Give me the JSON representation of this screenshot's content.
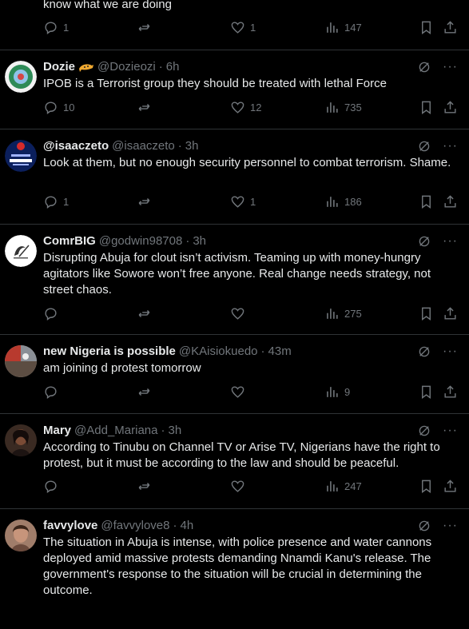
{
  "tweets": [
    {
      "partial": true,
      "text": "know what we are doing",
      "replies": "1",
      "reposts": "",
      "likes": "1",
      "views": "147"
    },
    {
      "name": "Dozie",
      "badge": true,
      "handle": "@Dozieozi",
      "time": "6h",
      "text": "IPOB is a Terrorist group they should be treated with lethal Force",
      "replies": "10",
      "reposts": "",
      "likes": "12",
      "views": "735"
    },
    {
      "name": "@isaaczeto",
      "handle": "@isaaczeto",
      "time": "3h",
      "text": "Look at them, but no enough security personnel to combat terrorism. Shame.",
      "replies": "1",
      "reposts": "",
      "likes": "1",
      "views": "186"
    },
    {
      "name": "ComrBIG",
      "handle": "@godwin98708",
      "time": "3h",
      "text": "Disrupting Abuja for clout isn’t activism. Teaming up with money-hungry agitators like Sowore won’t free anyone. Real change needs strategy, not street chaos.",
      "replies": "",
      "reposts": "",
      "likes": "",
      "views": "275"
    },
    {
      "name": "new Nigeria is possible",
      "handle": "@KAisiokuedo",
      "time": "43m",
      "text": "am joining d protest tomorrow",
      "replies": "",
      "reposts": "",
      "likes": "",
      "views": "9"
    },
    {
      "name": "Mary",
      "handle": "@Add_Mariana",
      "time": "3h",
      "text": "According to Tinubu on Channel TV or Arise TV, Nigerians have the right to protest, but it must be according to the law and should be peaceful.",
      "replies": "",
      "reposts": "",
      "likes": "",
      "views": "247"
    },
    {
      "name": "favvylove",
      "handle": "@favvylove8",
      "time": "4h",
      "text": "The situation in Abuja is intense, with police presence and water cannons deployed amid massive protests demanding Nnamdi Kanu's release. The government's response to the situation will be crucial in determining the outcome.",
      "replies": "",
      "reposts": "",
      "likes": "",
      "views": ""
    }
  ],
  "colors": {
    "background": "#000000",
    "text": "#e7e9ea",
    "muted": "#71767b",
    "divider": "#2f3336"
  },
  "icons": [
    "reply-icon",
    "repost-icon",
    "like-icon",
    "views-icon",
    "bookmark-icon",
    "share-icon",
    "grok-icon",
    "more-icon"
  ]
}
